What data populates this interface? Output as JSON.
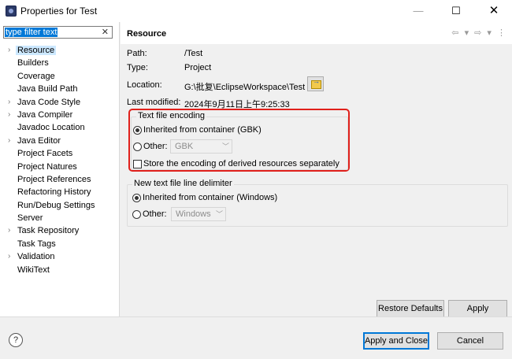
{
  "window": {
    "title": "Properties for Test",
    "minimize": "—",
    "maximize": "☐",
    "close": "✕"
  },
  "filter": {
    "value": "type filter text",
    "clear": "✕"
  },
  "tree": [
    {
      "label": "Resource",
      "arrow": "›",
      "selected": true
    },
    {
      "label": "Builders",
      "arrow": ""
    },
    {
      "label": "Coverage",
      "arrow": ""
    },
    {
      "label": "Java Build Path",
      "arrow": ""
    },
    {
      "label": "Java Code Style",
      "arrow": "›"
    },
    {
      "label": "Java Compiler",
      "arrow": "›"
    },
    {
      "label": "Javadoc Location",
      "arrow": ""
    },
    {
      "label": "Java Editor",
      "arrow": "›"
    },
    {
      "label": "Project Facets",
      "arrow": ""
    },
    {
      "label": "Project Natures",
      "arrow": ""
    },
    {
      "label": "Project References",
      "arrow": ""
    },
    {
      "label": "Refactoring History",
      "arrow": ""
    },
    {
      "label": "Run/Debug Settings",
      "arrow": ""
    },
    {
      "label": "Server",
      "arrow": ""
    },
    {
      "label": "Task Repository",
      "arrow": "›"
    },
    {
      "label": "Task Tags",
      "arrow": ""
    },
    {
      "label": "Validation",
      "arrow": "›"
    },
    {
      "label": "WikiText",
      "arrow": ""
    }
  ],
  "page": {
    "title": "Resource",
    "nav": "⇦ ▾ ⇨ ▾ ⋮"
  },
  "props": {
    "path_label": "Path:",
    "path_value": "/Test",
    "type_label": "Type:",
    "type_value": "Project",
    "location_label": "Location:",
    "location_value": "G:\\批复\\EclipseWorkspace\\Test",
    "modified_label": "Last modified:",
    "modified_value": "2024年9月11日上午9:25:33"
  },
  "encoding": {
    "group_title": "Text file encoding",
    "inherited_label": "Inherited from container (GBK)",
    "other_label": "Other:",
    "other_value": "GBK",
    "store_label": "Store the encoding of derived resources separately"
  },
  "delimiter": {
    "group_title": "New text file line delimiter",
    "inherited_label": "Inherited from container (Windows)",
    "other_label": "Other:",
    "other_value": "Windows"
  },
  "buttons": {
    "restore_defaults": "Restore Defaults",
    "apply": "Apply",
    "apply_and_close": "Apply and Close",
    "cancel": "Cancel",
    "help": "?"
  },
  "colors": {
    "highlight_box": "#e0201b",
    "selection": "#cce8ff",
    "filter_selection": "#0078d7"
  }
}
